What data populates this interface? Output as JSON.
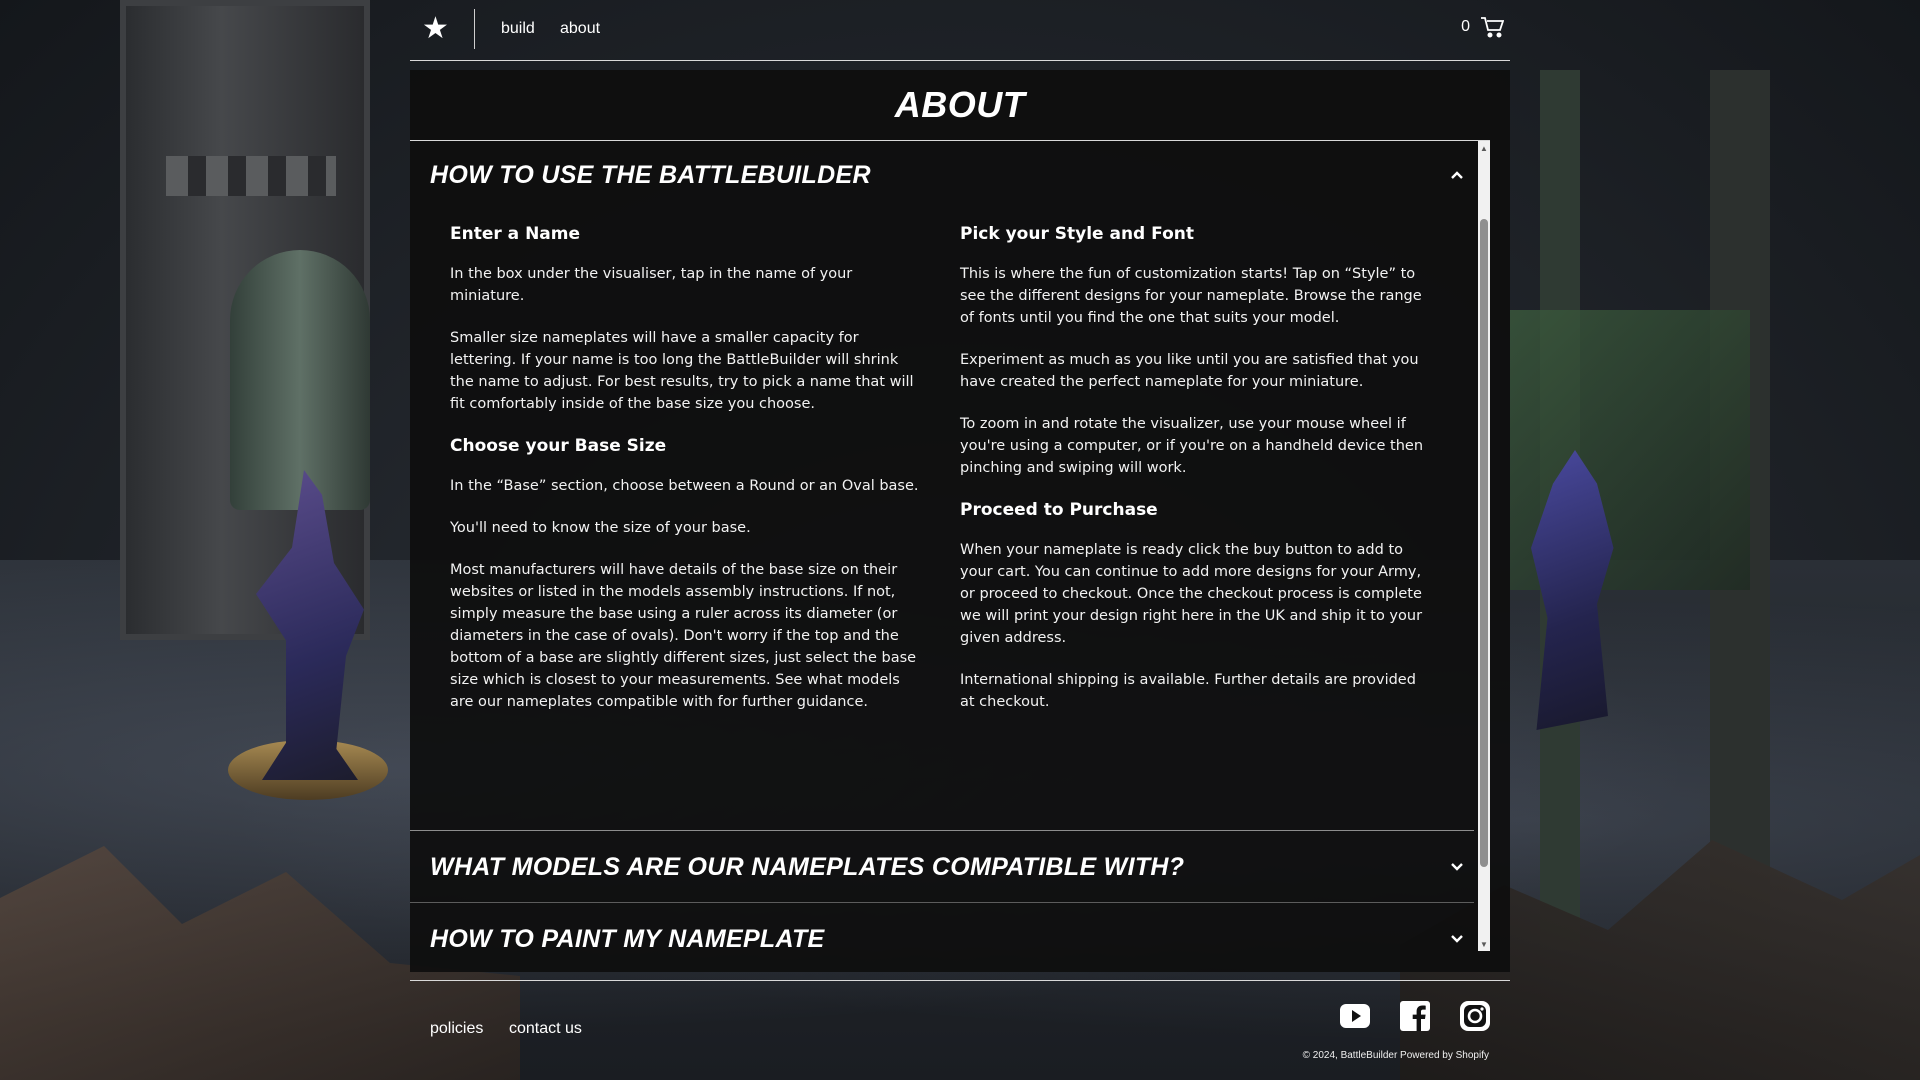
{
  "header": {
    "nav": {
      "build": "build",
      "about": "about"
    },
    "cart_count": "0"
  },
  "page_title": "ABOUT",
  "accordion": [
    {
      "title": "HOW TO USE THE BATTLEBUILDER",
      "expanded": true,
      "left_column": [
        {
          "heading": "Enter a Name",
          "paragraphs": [
            "In the box under the visualiser, tap in the name of your miniature.",
            "Smaller size nameplates will have a smaller capacity for lettering. If your name is too long the BattleBuilder will shrink the name to adjust. For best results, try to pick a name that will fit comfortably inside of the base size you choose."
          ]
        },
        {
          "heading": "Choose your Base Size",
          "paragraphs": [
            "In the “Base” section, choose between a Round or an Oval base.",
            "You'll need to know the size of your base.",
            "Most manufacturers will have details of the base size on their websites or listed in the models assembly instructions. If not, simply measure the base using a ruler across its diameter (or diameters in the case of ovals). Don't worry if the top and the bottom of a base are slightly different sizes, just select the base size which is closest to your measurements. See what models are our nameplates compatible with for further guidance."
          ]
        }
      ],
      "right_column": [
        {
          "heading": "Pick your Style and Font",
          "paragraphs": [
            "This is where the fun of customization starts! Tap on “Style” to see the different designs for your nameplate. Browse the range of fonts until you find the one that suits your model.",
            "Experiment as much as you like until you are satisfied that you have created the perfect nameplate for your miniature.",
            "To zoom in and rotate the visualizer, use your mouse wheel if you're using a computer, or if you're on a handheld device then pinching and swiping will work."
          ]
        },
        {
          "heading": "Proceed to Purchase",
          "paragraphs": [
            "When your nameplate is ready click the buy button to add to your cart. You can continue to add more designs for your Army, or proceed to checkout. Once the checkout process is complete we will print your design right here in the UK and ship it to your given address.",
            "International shipping is available. Further details are provided at checkout."
          ]
        }
      ]
    },
    {
      "title": "WHAT MODELS ARE OUR NAMEPLATES COMPATIBLE WITH?",
      "expanded": false
    },
    {
      "title": "HOW TO PAINT MY NAMEPLATE",
      "expanded": false
    }
  ],
  "footer": {
    "links": {
      "policies": "policies",
      "contact": "contact us"
    },
    "social": [
      "youtube-icon",
      "facebook-icon",
      "instagram-icon"
    ],
    "copyright": "© 2024, BattleBuilder Powered by Shopify"
  },
  "colors": {
    "panel_bg": "#0e0e0e",
    "text": "#ffffff",
    "rule": "#d9d9d9"
  }
}
